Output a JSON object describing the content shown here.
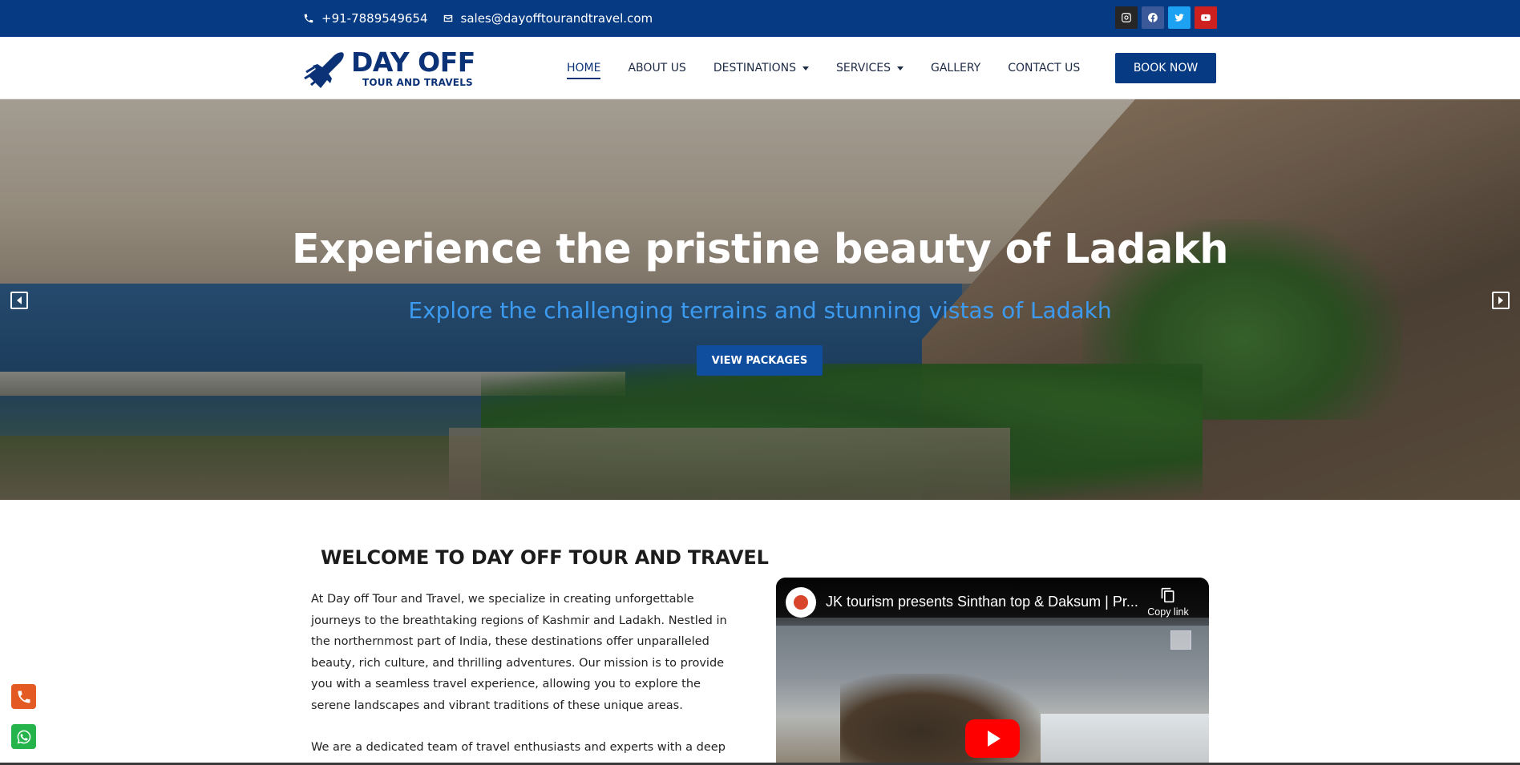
{
  "topbar": {
    "phone": "+91-7889549654",
    "email": "sales@dayofftourandtravel.com",
    "socials": [
      {
        "name": "instagram",
        "icon": "instagram-icon",
        "color": "#262626"
      },
      {
        "name": "facebook",
        "icon": "facebook-icon",
        "color": "#3b5998"
      },
      {
        "name": "twitter",
        "icon": "twitter-icon",
        "color": "#1da1f2"
      },
      {
        "name": "youtube",
        "icon": "youtube-icon",
        "color": "#cd201f"
      }
    ],
    "background": "#063a82"
  },
  "header": {
    "logo": {
      "line1": "DAY OFF",
      "line2": "TOUR AND TRAVELS",
      "icon": "airplane-icon"
    },
    "nav": [
      {
        "label": "HOME",
        "active": true
      },
      {
        "label": "ABOUT US"
      },
      {
        "label": "DESTINATIONS",
        "dropdown": true
      },
      {
        "label": "SERVICES",
        "dropdown": true
      },
      {
        "label": "GALLERY"
      },
      {
        "label": "CONTACT US"
      }
    ],
    "book_label": "BOOK NOW"
  },
  "hero": {
    "title": "Experience the pristine beauty of Ladakh",
    "subtitle": "Explore the challenging terrains and stunning vistas of Ladakh",
    "cta": "VIEW PACKAGES"
  },
  "welcome": {
    "title": "WELCOME TO DAY OFF TOUR AND TRAVEL",
    "para1": "At Day off Tour and Travel, we specialize in creating unforgettable journeys to the breathtaking regions of Kashmir and Ladakh. Nestled in the northernmost part of India, these destinations offer unparalleled beauty, rich culture, and thrilling adventures. Our mission is to provide you with a seamless travel experience, allowing you to explore the serene landscapes and vibrant traditions of these unique areas.",
    "para2": "We are a dedicated team of travel enthusiasts and experts with a deep love"
  },
  "video": {
    "title": "JK tourism presents Sinthan top & Daksum | Pr...",
    "copy_label": "Copy link"
  },
  "accent": "#063a82"
}
